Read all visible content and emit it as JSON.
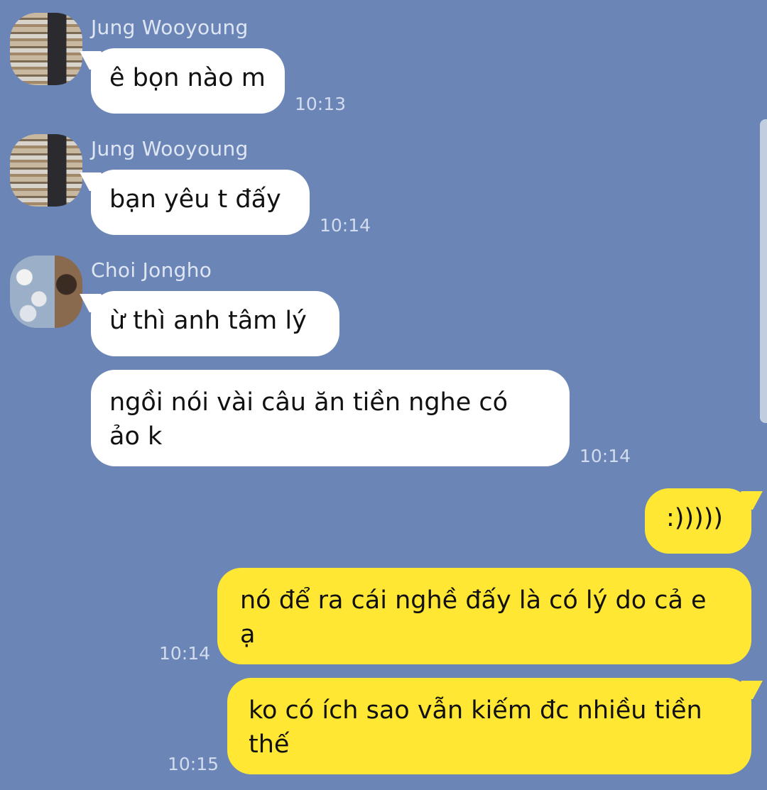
{
  "messages": [
    {
      "sender": "Jung Wooyoung",
      "text": "ê bọn nào m",
      "time": "10:13"
    },
    {
      "sender": "Jung Wooyoung",
      "text": "bạn yêu t đấy",
      "time": "10:14"
    },
    {
      "sender": "Choi Jongho",
      "text": "ừ thì anh tâm lý",
      "time": ""
    },
    {
      "sender": "Choi Jongho",
      "text": "ngồi nói vài câu ăn tiền nghe có\nảo k",
      "time": "10:14"
    },
    {
      "sender": "",
      "text": ":)))))",
      "time": ""
    },
    {
      "sender": "",
      "text": "nó để ra cái nghề đấy là có lý do cả e\nạ",
      "time": "10:14"
    },
    {
      "sender": "",
      "text": "ko có ích sao vẫn kiếm đc nhiều tiền\nthế",
      "time": "10:15"
    }
  ],
  "colors": {
    "background": "#6b86b6",
    "incoming_bubble": "#ffffff",
    "outgoing_bubble": "#ffe733"
  }
}
